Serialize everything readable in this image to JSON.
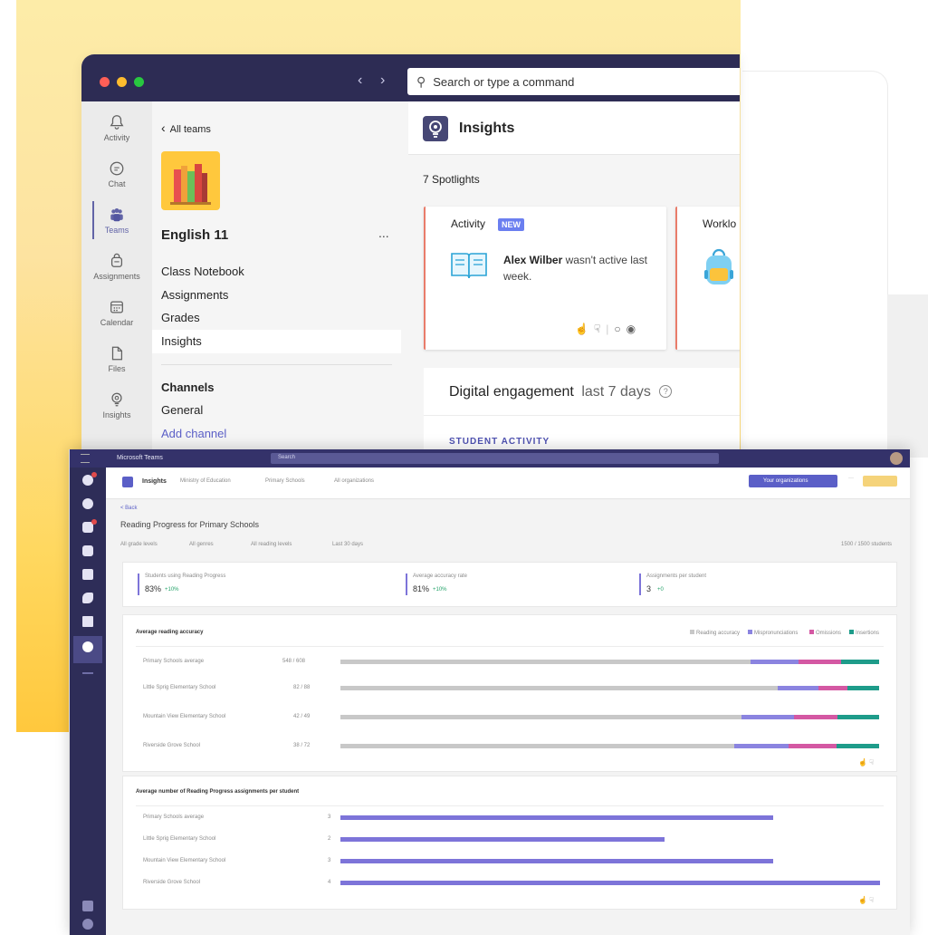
{
  "teams_window": {
    "search_placeholder": "Search or type a command",
    "rail": [
      {
        "label": "Activity",
        "icon": "bell-icon"
      },
      {
        "label": "Chat",
        "icon": "chat-icon"
      },
      {
        "label": "Teams",
        "icon": "teams-icon"
      },
      {
        "label": "Assignments",
        "icon": "backpack-icon"
      },
      {
        "label": "Calendar",
        "icon": "calendar-icon"
      },
      {
        "label": "Files",
        "icon": "file-icon"
      },
      {
        "label": "Insights",
        "icon": "lightbulb-icon"
      }
    ],
    "team_pane": {
      "back_label": "All teams",
      "team_name": "English 11",
      "more_label": "...",
      "nav": [
        "Class Notebook",
        "Assignments",
        "Grades",
        "Insights"
      ],
      "channels_heading": "Channels",
      "channels": [
        "General"
      ],
      "add_channel": "Add channel"
    },
    "main": {
      "title": "Insights",
      "spotlights_label": "7 Spotlights",
      "card_activity": {
        "title": "Activity",
        "badge": "NEW",
        "student": "Alex Wilber",
        "text": " wasn't active last week."
      },
      "card_workload": {
        "title": "Worklo"
      },
      "engagement": {
        "title": "Digital engagement",
        "period": "last 7 days",
        "help": "?",
        "section": "STUDENT ACTIVITY"
      }
    }
  },
  "reading_window": {
    "app_title": "Microsoft Teams",
    "search_placeholder": "Search",
    "breadcrumbs": [
      "Insights",
      "Ministry of Education",
      "Primary Schools",
      "All organizations"
    ],
    "org_button": "Your organizations",
    "back": "< Back",
    "page_title": "Reading Progress for Primary Schools",
    "filters": [
      "All grade levels",
      "All genres",
      "All reading levels",
      "Last 30 days"
    ],
    "student_count": "1500 / 1500 students",
    "kpis": [
      {
        "label": "Students using Reading Progress",
        "value": "83%",
        "delta": "+10%"
      },
      {
        "label": "Average accuracy rate",
        "value": "81%",
        "delta": "+10%"
      },
      {
        "label": "Assignments per student",
        "value": "3",
        "delta": "+0"
      }
    ],
    "accuracy_panel": {
      "title": "Average reading accuracy",
      "legend": [
        "Reading accuracy",
        "Mispronunciations",
        "Omissions",
        "Insertions"
      ],
      "rows": [
        {
          "label": "Primary Schools average",
          "value": "548 / 608"
        },
        {
          "label": "Little Sprig Elementary School",
          "value": "82 / 88"
        },
        {
          "label": "Mountain View Elementary School",
          "value": "42 / 49"
        },
        {
          "label": "Riverside Grove School",
          "value": "38 / 72"
        }
      ]
    },
    "assignments_panel": {
      "title": "Average number of Reading Progress assignments per student",
      "rows": [
        {
          "label": "Primary Schools average",
          "value": "3"
        },
        {
          "label": "Little Sprig Elementary School",
          "value": "2"
        },
        {
          "label": "Mountain View Elementary School",
          "value": "3"
        },
        {
          "label": "Riverside Grove School",
          "value": "4"
        }
      ]
    },
    "colors": {
      "purple": "#8b84e0",
      "pink": "#d458a3",
      "teal": "#1e9c8a",
      "accent": "#6264a7"
    }
  }
}
